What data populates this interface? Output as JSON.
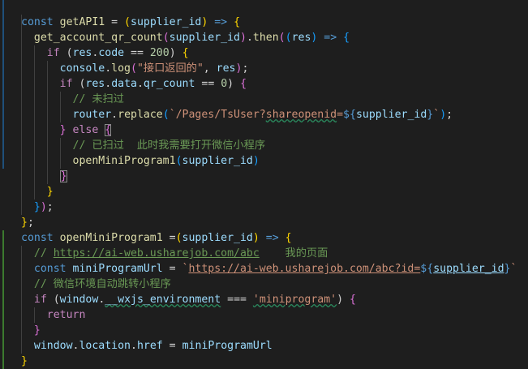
{
  "editor": {
    "language": "javascript",
    "lines": [
      [
        {
          "t": "const ",
          "c": "k"
        },
        {
          "t": "getAPI1",
          "c": "f"
        },
        {
          "t": " = ",
          "c": "p"
        },
        {
          "t": "(",
          "c": "y"
        },
        {
          "t": "supplier_id",
          "c": "v"
        },
        {
          "t": ")",
          "c": "y"
        },
        {
          "t": " => ",
          "c": "k"
        },
        {
          "t": "{",
          "c": "y"
        }
      ],
      [
        {
          "t": "  "
        },
        {
          "t": "get_account_qr_count",
          "c": "f"
        },
        {
          "t": "(",
          "c": "pk"
        },
        {
          "t": "supplier_id",
          "c": "v"
        },
        {
          "t": ")",
          "c": "pk"
        },
        {
          "t": ".",
          "c": "p"
        },
        {
          "t": "then",
          "c": "f"
        },
        {
          "t": "(",
          "c": "pk"
        },
        {
          "t": "(",
          "c": "b"
        },
        {
          "t": "res",
          "c": "v"
        },
        {
          "t": ")",
          "c": "b"
        },
        {
          "t": " => ",
          "c": "k"
        },
        {
          "t": "{",
          "c": "b"
        }
      ],
      [
        {
          "t": "    "
        },
        {
          "t": "if",
          "c": "c"
        },
        {
          "t": " ("
        },
        {
          "t": "res",
          "c": "v"
        },
        {
          "t": ".",
          "c": "p"
        },
        {
          "t": "code",
          "c": "v"
        },
        {
          "t": " == ",
          "c": "p"
        },
        {
          "t": "200",
          "c": "n"
        },
        {
          "t": ") "
        },
        {
          "t": "{",
          "c": "y"
        }
      ],
      [
        {
          "t": "      "
        },
        {
          "t": "console",
          "c": "v"
        },
        {
          "t": ".",
          "c": "p"
        },
        {
          "t": "log",
          "c": "f"
        },
        {
          "t": "(",
          "c": "pk"
        },
        {
          "t": "\"接口返回的\"",
          "c": "s"
        },
        {
          "t": ", ",
          "c": "p"
        },
        {
          "t": "res",
          "c": "v"
        },
        {
          "t": ")",
          "c": "pk"
        },
        {
          "t": ";",
          "c": "p"
        }
      ],
      [
        {
          "t": "      "
        },
        {
          "t": "if",
          "c": "c"
        },
        {
          "t": " ("
        },
        {
          "t": "res",
          "c": "v"
        },
        {
          "t": ".",
          "c": "p"
        },
        {
          "t": "data",
          "c": "v"
        },
        {
          "t": ".",
          "c": "p"
        },
        {
          "t": "qr_count",
          "c": "v"
        },
        {
          "t": " == ",
          "c": "p"
        },
        {
          "t": "0",
          "c": "n"
        },
        {
          "t": ") "
        },
        {
          "t": "{",
          "c": "pk"
        }
      ],
      [
        {
          "t": "        "
        },
        {
          "t": "// 未扫过",
          "c": "m"
        }
      ],
      [
        {
          "t": "        "
        },
        {
          "t": "router",
          "c": "v"
        },
        {
          "t": ".",
          "c": "p"
        },
        {
          "t": "replace",
          "c": "f"
        },
        {
          "t": "(",
          "c": "b"
        },
        {
          "t": "`/Pages/TsUser?",
          "c": "s"
        },
        {
          "t": "shareopenid",
          "c": "s",
          "x": 1
        },
        {
          "t": "=",
          "c": "s"
        },
        {
          "t": "${",
          "c": "k"
        },
        {
          "t": "supplier_id",
          "c": "v"
        },
        {
          "t": "}",
          "c": "k"
        },
        {
          "t": "`",
          "c": "s"
        },
        {
          "t": ")",
          "c": "b"
        },
        {
          "t": ";",
          "c": "p"
        }
      ],
      [
        {
          "t": "      "
        },
        {
          "t": "}",
          "c": "pk"
        },
        {
          "t": " else ",
          "c": "c"
        },
        {
          "t": "{",
          "c": "pk",
          "box": 1
        }
      ],
      [
        {
          "t": "        "
        },
        {
          "t": "// 已扫过  此时我需要打开微信小程序",
          "c": "m"
        }
      ],
      [
        {
          "t": "        "
        },
        {
          "t": "openMiniProgram1",
          "c": "f"
        },
        {
          "t": "(",
          "c": "b"
        },
        {
          "t": "supplier_id",
          "c": "v"
        },
        {
          "t": ")",
          "c": "b"
        }
      ],
      [
        {
          "t": "      "
        },
        {
          "t": "}",
          "c": "pk",
          "box": 1,
          "bl": 1
        }
      ],
      [
        {
          "t": "    "
        },
        {
          "t": "}",
          "c": "y"
        }
      ],
      [
        {
          "t": "  "
        },
        {
          "t": "}",
          "c": "b"
        },
        {
          "t": ")",
          "c": "pk"
        },
        {
          "t": ";",
          "c": "p"
        }
      ],
      [
        {
          "t": "}",
          "c": "y"
        },
        {
          "t": ";",
          "c": "p"
        }
      ],
      [
        {
          "t": "const ",
          "c": "k"
        },
        {
          "t": "openMiniProgram1",
          "c": "f"
        },
        {
          "t": " =",
          "c": "p"
        },
        {
          "t": "(",
          "c": "y"
        },
        {
          "t": "supplier_id",
          "c": "v"
        },
        {
          "t": ")",
          "c": "y"
        },
        {
          "t": " => ",
          "c": "k"
        },
        {
          "t": "{",
          "c": "y"
        }
      ],
      [
        {
          "t": "  "
        },
        {
          "t": "// ",
          "c": "m"
        },
        {
          "t": "https://ai-web.usharejob.com/abc",
          "c": "m",
          "u": 1
        },
        {
          "t": "    我的页面",
          "c": "m"
        }
      ],
      [
        {
          "t": "  "
        },
        {
          "t": "const ",
          "c": "k"
        },
        {
          "t": "miniProgramUrl",
          "c": "v"
        },
        {
          "t": " = ",
          "c": "p"
        },
        {
          "t": "`",
          "c": "s"
        },
        {
          "t": "https://ai-web.usharejob.com/abc?id=",
          "c": "s",
          "u": 1
        },
        {
          "t": "${",
          "c": "k"
        },
        {
          "t": "supplier_id",
          "c": "v",
          "u": 1
        },
        {
          "t": "}",
          "c": "k"
        },
        {
          "t": "`",
          "c": "s"
        }
      ],
      [
        {
          "t": "  "
        },
        {
          "t": "// 微信环境自动跳转小程序",
          "c": "m"
        }
      ],
      [
        {
          "t": "  "
        },
        {
          "t": "if",
          "c": "c"
        },
        {
          "t": " ("
        },
        {
          "t": "window",
          "c": "v"
        },
        {
          "t": ".",
          "c": "p"
        },
        {
          "t": "__wxjs_environment",
          "c": "v",
          "x": 1
        },
        {
          "t": " === ",
          "c": "p"
        },
        {
          "t": "'miniprogram'",
          "c": "s",
          "x": 1
        },
        {
          "t": ") "
        },
        {
          "t": "{",
          "c": "pk"
        }
      ],
      [
        {
          "t": "    "
        },
        {
          "t": "return",
          "c": "c"
        }
      ],
      [
        {
          "t": "  "
        },
        {
          "t": "}",
          "c": "pk"
        }
      ],
      [
        {
          "t": "  "
        },
        {
          "t": "window",
          "c": "v"
        },
        {
          "t": ".",
          "c": "p"
        },
        {
          "t": "location",
          "c": "v"
        },
        {
          "t": ".",
          "c": "p"
        },
        {
          "t": "href",
          "c": "v"
        },
        {
          "t": " = ",
          "c": "p"
        },
        {
          "t": "miniProgramUrl",
          "c": "v"
        }
      ],
      [
        {
          "t": "}",
          "c": "y"
        }
      ]
    ]
  },
  "colors": {
    "background": "#1e1e1e",
    "keyword": "#569cd6",
    "control": "#c586c0",
    "function": "#dcdcaa",
    "variable": "#9cdcfe",
    "string": "#ce9178",
    "number": "#b5cea8",
    "comment": "#6a9955",
    "bracket_gold": "#ffd700",
    "bracket_orchid": "#da70d6",
    "bracket_blue": "#179fff"
  }
}
